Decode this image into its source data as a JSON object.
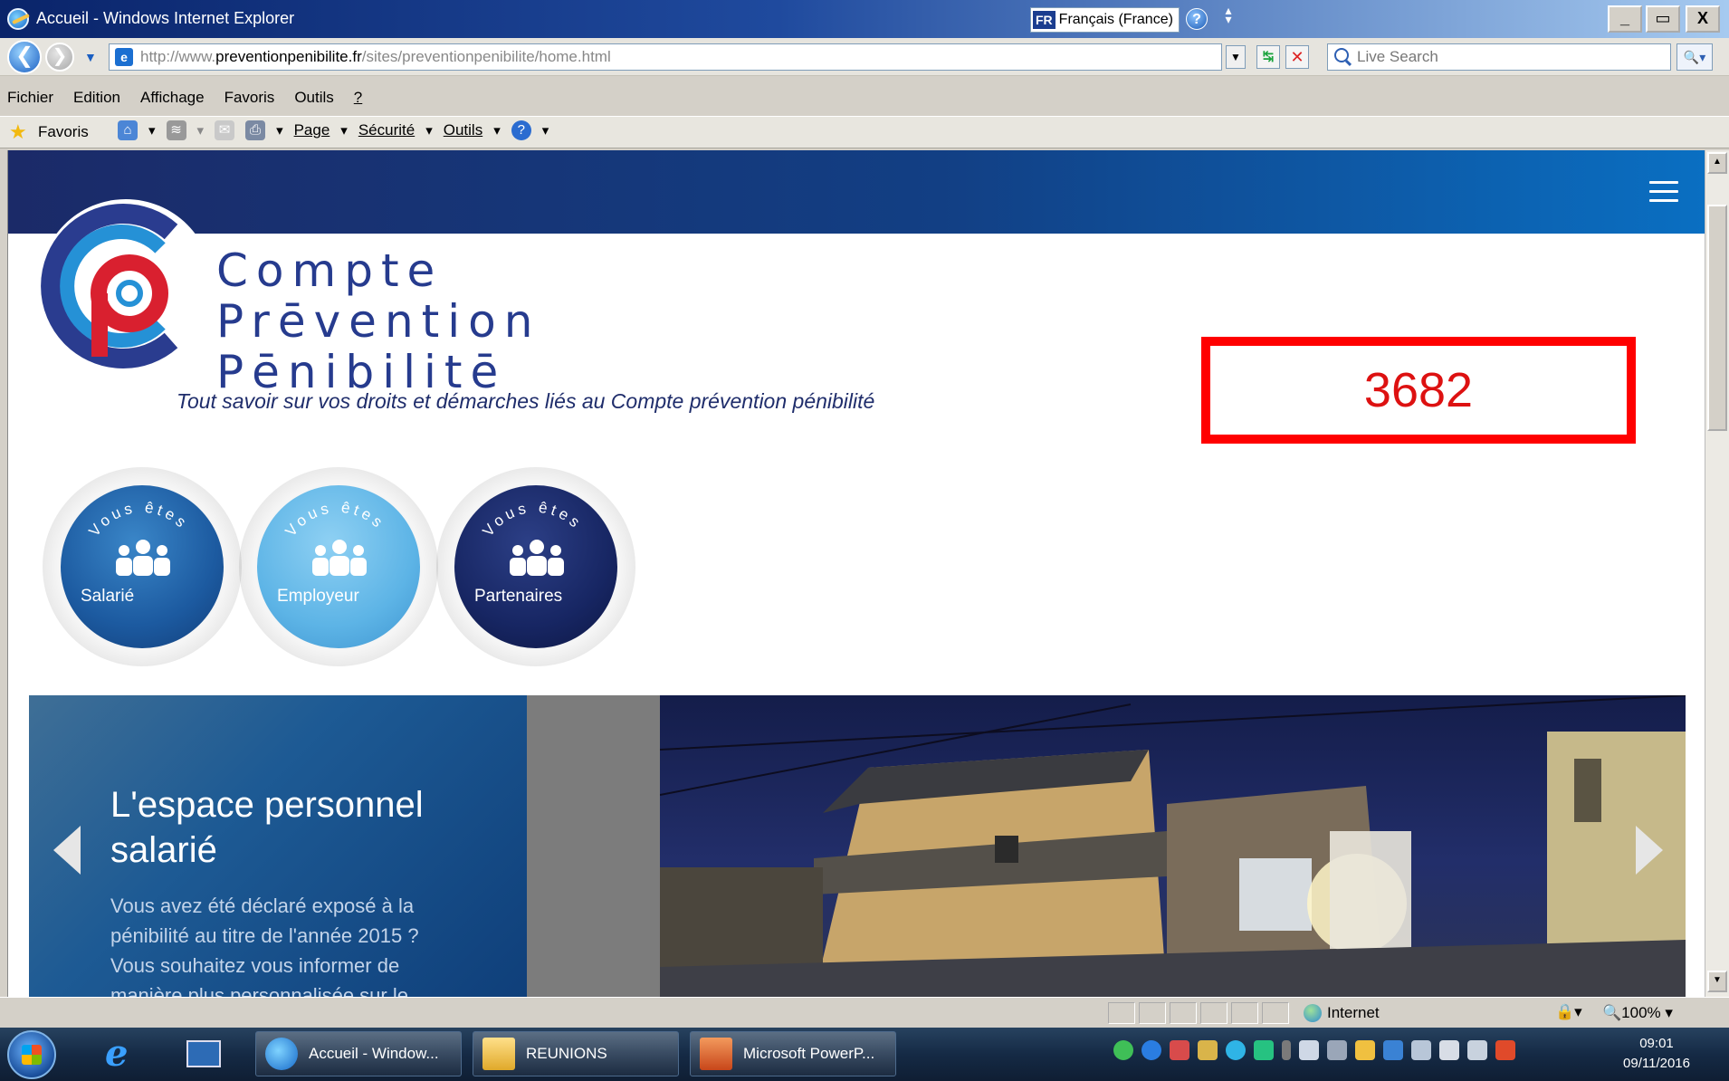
{
  "window": {
    "title": "Accueil - Windows Internet Explorer",
    "language_code": "FR",
    "language_label": "Français (France)",
    "minimize": "_",
    "maximize": "▭",
    "close": "X"
  },
  "address": {
    "url_prefix": "http://www.",
    "url_domain": "preventionpenibilite.fr",
    "url_path": "/sites/preventionpenibilite/home.html",
    "search_placeholder": "Live Search"
  },
  "menu": [
    "Fichier",
    "Edition",
    "Affichage",
    "Favoris",
    "Outils",
    "?"
  ],
  "favbar": {
    "favoris": "Favoris",
    "page": "Page",
    "securite": "Sécurité",
    "outils": "Outils"
  },
  "site": {
    "logo_line1": "Compte",
    "logo_line2": "Prēvention",
    "logo_line3": "Pēnibilitē",
    "tagline": "Tout savoir sur vos droits et démarches liés au Compte prévention pénibilité",
    "counter": "3682",
    "circles": [
      {
        "arc": "Vous êtes",
        "label": "Salarié",
        "color": "#1c63a8"
      },
      {
        "arc": "Vous êtes",
        "label": "Employeur",
        "color": "#5db4e6"
      },
      {
        "arc": "Vous êtes",
        "label": "Partenaires",
        "color": "#14225c"
      }
    ],
    "slide": {
      "title": "L'espace personnel salarié",
      "text": "Vous avez été déclaré exposé à la pénibilité au titre de l'année 2015 ? Vous souhaitez vous informer de manière plus personnalisée sur le"
    }
  },
  "status": {
    "zone": "Internet",
    "zoom": "100%"
  },
  "taskbar": {
    "items": [
      "Accueil - Window...",
      "REUNIONS",
      "Microsoft PowerP..."
    ],
    "time": "09:01",
    "date": "09/11/2016"
  }
}
